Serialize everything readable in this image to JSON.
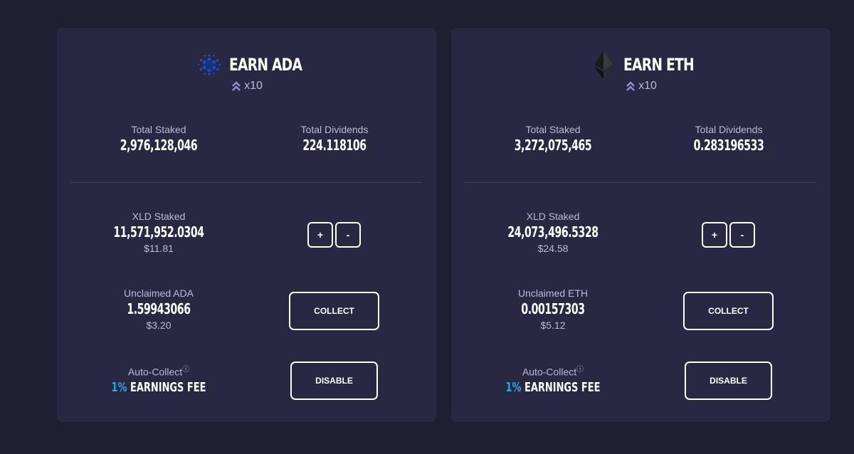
{
  "cards": [
    {
      "title": "EARN ADA",
      "coin_icon": "cardano-icon",
      "multiplier": "x10",
      "total_staked_label": "Total Staked",
      "total_staked": "2,976,128,046",
      "total_dividends_label": "Total Dividends",
      "total_dividends": "224.118106",
      "xld_staked_label": "XLD Staked",
      "xld_staked": "11,571,952.0304",
      "xld_staked_usd": "$11.81",
      "plus": "+",
      "minus": "-",
      "unclaimed_label": "Unclaimed ADA",
      "unclaimed": "1.59943066",
      "unclaimed_usd": "$3.20",
      "collect": "COLLECT",
      "auto_collect_label": "Auto-Collect",
      "help_icon": "?",
      "fee_pct": "1%",
      "fee_text": " EARNINGS FEE",
      "disable": "DISABLE"
    },
    {
      "title": "EARN ETH",
      "coin_icon": "ethereum-icon",
      "multiplier": "x10",
      "total_staked_label": "Total Staked",
      "total_staked": "3,272,075,465",
      "total_dividends_label": "Total Dividends",
      "total_dividends": "0.283196533",
      "xld_staked_label": "XLD Staked",
      "xld_staked": "24,073,496.5328",
      "xld_staked_usd": "$24.58",
      "plus": "+",
      "minus": "-",
      "unclaimed_label": "Unclaimed ETH",
      "unclaimed": "0.00157303",
      "unclaimed_usd": "$5.12",
      "collect": "COLLECT",
      "auto_collect_label": "Auto-Collect",
      "help_icon": "?",
      "fee_pct": "1%",
      "fee_text": " EARNINGS FEE",
      "disable": "DISABLE"
    }
  ],
  "colors": {
    "page_bg": "#1f1f33",
    "card_bg": "#282843",
    "accent": "#29a8e6",
    "muted_text": "#b8bcd8"
  }
}
